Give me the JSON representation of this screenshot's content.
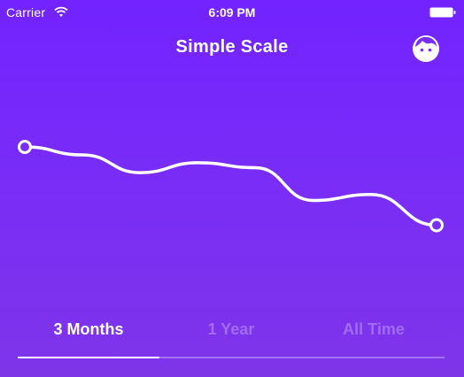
{
  "status_bar": {
    "carrier": "Carrier",
    "time": "6:09 PM",
    "icons": [
      "wifi-icon",
      "battery-icon"
    ]
  },
  "nav": {
    "title": "Simple Scale",
    "right_icon": "face-icon"
  },
  "colors": {
    "background_top": "#7223ff",
    "background_bottom": "#7e35e8",
    "line": "#ffffff"
  },
  "chart_data": {
    "type": "line",
    "xlabel": "",
    "ylabel": "",
    "ylim": [
      0,
      100
    ],
    "grid": false,
    "legend": "none",
    "series": [
      {
        "x": [
          0,
          14,
          28,
          42,
          56,
          70,
          84,
          100
        ],
        "values": [
          100,
          92,
          74,
          84,
          79,
          46,
          52,
          21
        ],
        "start_marker": "hollow-circle",
        "end_marker": "hollow-circle"
      }
    ]
  },
  "tabs": [
    {
      "label": "3 Months",
      "active": true
    },
    {
      "label": "1 Year",
      "active": false
    },
    {
      "label": "All Time",
      "active": false
    }
  ],
  "selected_tab_index": 0
}
